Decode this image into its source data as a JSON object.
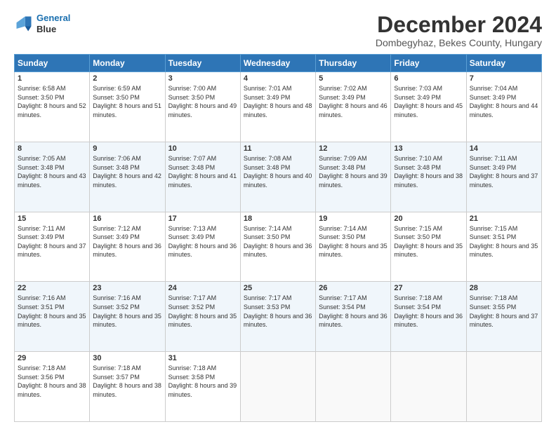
{
  "logo": {
    "line1": "General",
    "line2": "Blue"
  },
  "header": {
    "month": "December 2024",
    "location": "Dombegyhaz, Bekes County, Hungary"
  },
  "weekdays": [
    "Sunday",
    "Monday",
    "Tuesday",
    "Wednesday",
    "Thursday",
    "Friday",
    "Saturday"
  ],
  "weeks": [
    [
      {
        "day": "1",
        "sunrise": "Sunrise: 6:58 AM",
        "sunset": "Sunset: 3:50 PM",
        "daylight": "Daylight: 8 hours and 52 minutes."
      },
      {
        "day": "2",
        "sunrise": "Sunrise: 6:59 AM",
        "sunset": "Sunset: 3:50 PM",
        "daylight": "Daylight: 8 hours and 51 minutes."
      },
      {
        "day": "3",
        "sunrise": "Sunrise: 7:00 AM",
        "sunset": "Sunset: 3:50 PM",
        "daylight": "Daylight: 8 hours and 49 minutes."
      },
      {
        "day": "4",
        "sunrise": "Sunrise: 7:01 AM",
        "sunset": "Sunset: 3:49 PM",
        "daylight": "Daylight: 8 hours and 48 minutes."
      },
      {
        "day": "5",
        "sunrise": "Sunrise: 7:02 AM",
        "sunset": "Sunset: 3:49 PM",
        "daylight": "Daylight: 8 hours and 46 minutes."
      },
      {
        "day": "6",
        "sunrise": "Sunrise: 7:03 AM",
        "sunset": "Sunset: 3:49 PM",
        "daylight": "Daylight: 8 hours and 45 minutes."
      },
      {
        "day": "7",
        "sunrise": "Sunrise: 7:04 AM",
        "sunset": "Sunset: 3:49 PM",
        "daylight": "Daylight: 8 hours and 44 minutes."
      }
    ],
    [
      {
        "day": "8",
        "sunrise": "Sunrise: 7:05 AM",
        "sunset": "Sunset: 3:48 PM",
        "daylight": "Daylight: 8 hours and 43 minutes."
      },
      {
        "day": "9",
        "sunrise": "Sunrise: 7:06 AM",
        "sunset": "Sunset: 3:48 PM",
        "daylight": "Daylight: 8 hours and 42 minutes."
      },
      {
        "day": "10",
        "sunrise": "Sunrise: 7:07 AM",
        "sunset": "Sunset: 3:48 PM",
        "daylight": "Daylight: 8 hours and 41 minutes."
      },
      {
        "day": "11",
        "sunrise": "Sunrise: 7:08 AM",
        "sunset": "Sunset: 3:48 PM",
        "daylight": "Daylight: 8 hours and 40 minutes."
      },
      {
        "day": "12",
        "sunrise": "Sunrise: 7:09 AM",
        "sunset": "Sunset: 3:48 PM",
        "daylight": "Daylight: 8 hours and 39 minutes."
      },
      {
        "day": "13",
        "sunrise": "Sunrise: 7:10 AM",
        "sunset": "Sunset: 3:48 PM",
        "daylight": "Daylight: 8 hours and 38 minutes."
      },
      {
        "day": "14",
        "sunrise": "Sunrise: 7:11 AM",
        "sunset": "Sunset: 3:49 PM",
        "daylight": "Daylight: 8 hours and 37 minutes."
      }
    ],
    [
      {
        "day": "15",
        "sunrise": "Sunrise: 7:11 AM",
        "sunset": "Sunset: 3:49 PM",
        "daylight": "Daylight: 8 hours and 37 minutes."
      },
      {
        "day": "16",
        "sunrise": "Sunrise: 7:12 AM",
        "sunset": "Sunset: 3:49 PM",
        "daylight": "Daylight: 8 hours and 36 minutes."
      },
      {
        "day": "17",
        "sunrise": "Sunrise: 7:13 AM",
        "sunset": "Sunset: 3:49 PM",
        "daylight": "Daylight: 8 hours and 36 minutes."
      },
      {
        "day": "18",
        "sunrise": "Sunrise: 7:14 AM",
        "sunset": "Sunset: 3:50 PM",
        "daylight": "Daylight: 8 hours and 36 minutes."
      },
      {
        "day": "19",
        "sunrise": "Sunrise: 7:14 AM",
        "sunset": "Sunset: 3:50 PM",
        "daylight": "Daylight: 8 hours and 35 minutes."
      },
      {
        "day": "20",
        "sunrise": "Sunrise: 7:15 AM",
        "sunset": "Sunset: 3:50 PM",
        "daylight": "Daylight: 8 hours and 35 minutes."
      },
      {
        "day": "21",
        "sunrise": "Sunrise: 7:15 AM",
        "sunset": "Sunset: 3:51 PM",
        "daylight": "Daylight: 8 hours and 35 minutes."
      }
    ],
    [
      {
        "day": "22",
        "sunrise": "Sunrise: 7:16 AM",
        "sunset": "Sunset: 3:51 PM",
        "daylight": "Daylight: 8 hours and 35 minutes."
      },
      {
        "day": "23",
        "sunrise": "Sunrise: 7:16 AM",
        "sunset": "Sunset: 3:52 PM",
        "daylight": "Daylight: 8 hours and 35 minutes."
      },
      {
        "day": "24",
        "sunrise": "Sunrise: 7:17 AM",
        "sunset": "Sunset: 3:52 PM",
        "daylight": "Daylight: 8 hours and 35 minutes."
      },
      {
        "day": "25",
        "sunrise": "Sunrise: 7:17 AM",
        "sunset": "Sunset: 3:53 PM",
        "daylight": "Daylight: 8 hours and 36 minutes."
      },
      {
        "day": "26",
        "sunrise": "Sunrise: 7:17 AM",
        "sunset": "Sunset: 3:54 PM",
        "daylight": "Daylight: 8 hours and 36 minutes."
      },
      {
        "day": "27",
        "sunrise": "Sunrise: 7:18 AM",
        "sunset": "Sunset: 3:54 PM",
        "daylight": "Daylight: 8 hours and 36 minutes."
      },
      {
        "day": "28",
        "sunrise": "Sunrise: 7:18 AM",
        "sunset": "Sunset: 3:55 PM",
        "daylight": "Daylight: 8 hours and 37 minutes."
      }
    ],
    [
      {
        "day": "29",
        "sunrise": "Sunrise: 7:18 AM",
        "sunset": "Sunset: 3:56 PM",
        "daylight": "Daylight: 8 hours and 38 minutes."
      },
      {
        "day": "30",
        "sunrise": "Sunrise: 7:18 AM",
        "sunset": "Sunset: 3:57 PM",
        "daylight": "Daylight: 8 hours and 38 minutes."
      },
      {
        "day": "31",
        "sunrise": "Sunrise: 7:18 AM",
        "sunset": "Sunset: 3:58 PM",
        "daylight": "Daylight: 8 hours and 39 minutes."
      },
      null,
      null,
      null,
      null
    ]
  ]
}
